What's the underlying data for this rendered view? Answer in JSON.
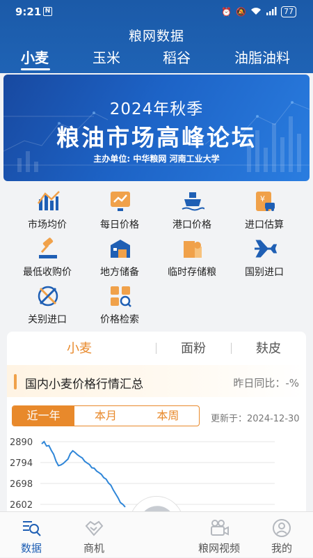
{
  "status": {
    "time": "9:21",
    "battery": "77"
  },
  "app": {
    "title": "粮网数据"
  },
  "tabs": [
    "小麦",
    "玉米",
    "稻谷",
    "油脂油料"
  ],
  "banner": {
    "year_line": "2024年秋季",
    "title": "粮油市场高峰论坛",
    "host_line": "主办单位:  中华粮网   河南工业大学"
  },
  "grid": [
    {
      "label": "市场均价",
      "icon": "bar-chart-icon"
    },
    {
      "label": "每日价格",
      "icon": "price-monitor-icon"
    },
    {
      "label": "港口价格",
      "icon": "ship-icon"
    },
    {
      "label": "进口估算",
      "icon": "import-calculator-icon"
    },
    {
      "label": "最低收购价",
      "icon": "gavel-icon"
    },
    {
      "label": "地方储备",
      "icon": "warehouse-icon"
    },
    {
      "label": "临时存储粮",
      "icon": "storage-box-icon"
    },
    {
      "label": "国别进口",
      "icon": "airplane-icon"
    },
    {
      "label": "关别进口",
      "icon": "customs-icon"
    },
    {
      "label": "价格检索",
      "icon": "search-price-icon"
    }
  ],
  "subtabs": [
    "小麦",
    "面粉",
    "麸皮"
  ],
  "summary": {
    "title": "国内小麦价格行情汇总",
    "change": "昨日同比：-%"
  },
  "period": [
    "近一年",
    "本月",
    "本周"
  ],
  "updated": "更新于：2024-12-30",
  "colors": {
    "brand": "#1f5fb4",
    "accent": "#e8892b",
    "line": "#2f86d8"
  },
  "chart_data": {
    "type": "line",
    "yticks": [
      "2890",
      "2794",
      "2698",
      "2602"
    ],
    "series": [
      {
        "values": [
          2880,
          2890,
          2870,
          2872,
          2850,
          2832,
          2800,
          2780,
          2783,
          2790,
          2800,
          2810,
          2835,
          2848,
          2840,
          2830,
          2822,
          2815,
          2800,
          2792,
          2785,
          2770,
          2768,
          2755,
          2748,
          2740,
          2725,
          2718,
          2700,
          2690,
          2668,
          2650,
          2632,
          2610,
          2602,
          2590
        ]
      }
    ]
  },
  "nav": [
    "数据",
    "商机",
    "粮网视频",
    "我的"
  ]
}
